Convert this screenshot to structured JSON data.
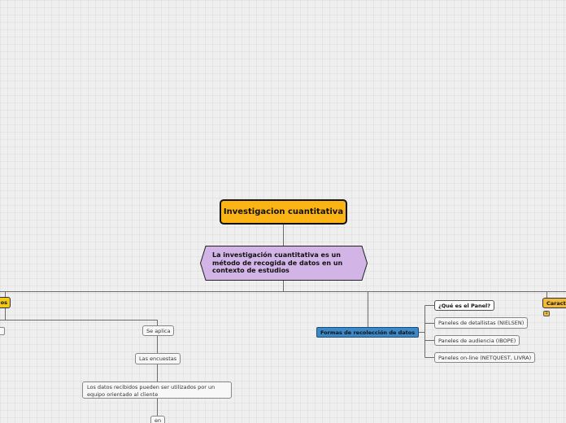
{
  "map": {
    "root": {
      "label": "Investigacion cuantitativa"
    },
    "definition": {
      "label": "La investigación cuantitativa es un método de recogida de datos en un contexto de estudios"
    },
    "left_branch": {
      "label": "os",
      "se_aplica": "Se aplica",
      "encuestas": "Las encuestas",
      "datos": "Los datos recibidos pueden ser utilizados por un equipo orientado al cliente",
      "en": "en"
    },
    "center_branch": {
      "label": "Formas de recolección de datos",
      "items": [
        "¿Qué es el Panel?",
        "Paneles de detallistas (NIELSEN)",
        "Paneles de audiencia (IBOPE)",
        "Paneles on-line (NETQUEST, LIVRA)"
      ]
    },
    "right_branch": {
      "label": "Caracte",
      "badge": "1"
    }
  },
  "colors": {
    "root_fill": "#fcb415",
    "definition_fill": "#d2b5e6",
    "branch_yellow": "#f2c81c",
    "branch_blue": "#3d88c7",
    "branch_orange": "#f2b93a",
    "connector": "#6b6b6b"
  }
}
